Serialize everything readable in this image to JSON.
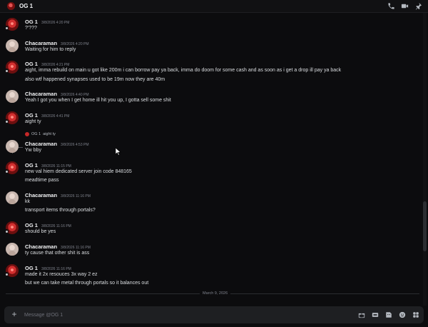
{
  "channel": {
    "title": "OG 1"
  },
  "messages": [
    {
      "author": "OG 1",
      "kind": "og",
      "timestamp": "3/8/2026 4:20 PM",
      "lines": [
        "?'???"
      ]
    },
    {
      "author": "Chacaraman",
      "kind": "ch",
      "timestamp": "3/8/2026 4:20 PM",
      "lines": [
        "Waiting for him to reply"
      ]
    },
    {
      "author": "OG 1",
      "kind": "og",
      "timestamp": "3/8/2026 4:21 PM",
      "lines": [
        "aight, imma rebuild on main u got like 200m i can borrow pay ya back, imma do doom for some cash and as soon as i get a drop ill pay ya back",
        "also wtf happened synapses used to be 19m now they are 40m"
      ]
    },
    {
      "author": "Chacaraman",
      "kind": "ch",
      "timestamp": "3/8/2026 4:40 PM",
      "lines": [
        "Yeah I got you when I get home ill hit you up, I gotta sell some shit"
      ]
    },
    {
      "author": "OG 1",
      "kind": "og",
      "timestamp": "3/8/2026 4:41 PM",
      "lines": [
        "aight ty"
      ]
    },
    {
      "author": "Chacaraman",
      "kind": "ch",
      "timestamp": "3/8/2026 4:53 PM",
      "lines": [
        "Yw bby"
      ],
      "reply_to": {
        "author": "OG 1",
        "text": "aight ty"
      }
    },
    {
      "author": "OG 1",
      "kind": "og",
      "timestamp": "3/8/2026 11:15 PM",
      "lines": [
        "new val hiem dedicated server join code   848165",
        "meadtime    pass"
      ]
    },
    {
      "author": "Chacaraman",
      "kind": "ch",
      "timestamp": "3/8/2026 11:16 PM",
      "lines": [
        "kk",
        "transport items through portals?"
      ]
    },
    {
      "author": "OG 1",
      "kind": "og",
      "timestamp": "3/8/2026 11:16 PM",
      "lines": [
        "should be yes"
      ]
    },
    {
      "author": "Chacaraman",
      "kind": "ch",
      "timestamp": "3/8/2026 11:16 PM",
      "lines": [
        "ty cause that other shit is ass"
      ]
    },
    {
      "author": "OG 1",
      "kind": "og",
      "timestamp": "3/8/2026 11:16 PM",
      "lines": [
        "made it 2x resouces 3x way 2 ez",
        "but we can take metal through portals so it balances out"
      ]
    }
  ],
  "date_divider": "March 9, 2026",
  "composer": {
    "placeholder": "Message @OG 1"
  },
  "icons": {
    "header": [
      "phone-call-icon",
      "video-call-icon",
      "pin-icon"
    ],
    "composer": [
      "gift-icon",
      "gif-icon",
      "sticker-icon",
      "emoji-icon",
      "apps-icon"
    ]
  },
  "colors": {
    "background": "#0c0c0e",
    "text": "#dbdee1",
    "muted": "#80848e",
    "og_avatar": "#d32f2f"
  }
}
